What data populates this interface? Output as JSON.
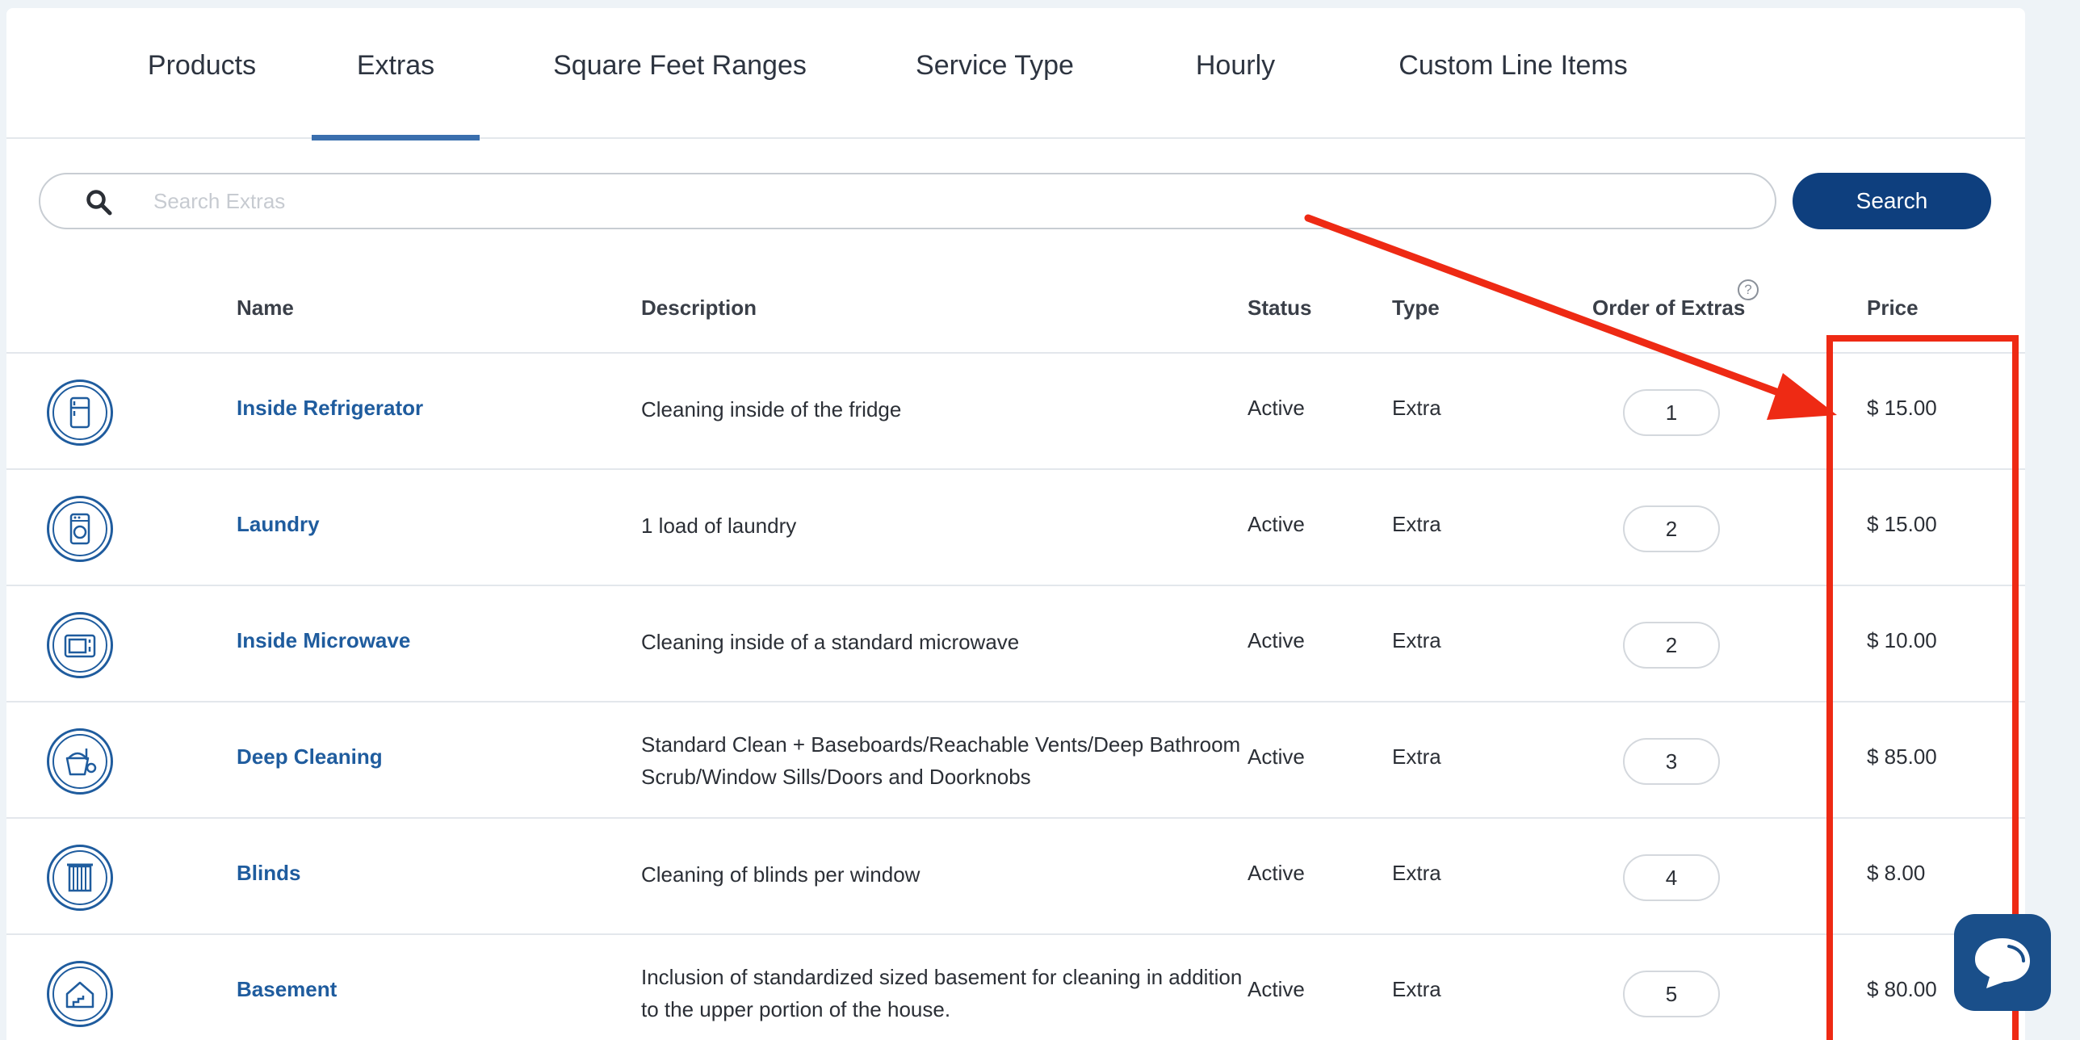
{
  "tabs": [
    {
      "label": "Products",
      "active": false
    },
    {
      "label": "Extras",
      "active": true
    },
    {
      "label": "Square Feet Ranges",
      "active": false
    },
    {
      "label": "Service Type",
      "active": false
    },
    {
      "label": "Hourly",
      "active": false
    },
    {
      "label": "Custom Line Items",
      "active": false
    }
  ],
  "search": {
    "placeholder": "Search Extras",
    "value": "",
    "button_label": "Search"
  },
  "table": {
    "columns": {
      "name": "Name",
      "description": "Description",
      "status": "Status",
      "type": "Type",
      "order": "Order of Extras",
      "price": "Price"
    },
    "help_icon_glyph": "?",
    "rows": [
      {
        "icon": "refrigerator-icon",
        "name": "Inside Refrigerator",
        "description": "Cleaning inside of the fridge",
        "status": "Active",
        "type": "Extra",
        "order": "1",
        "price": "$ 15.00"
      },
      {
        "icon": "washing-machine-icon",
        "name": "Laundry",
        "description": "1 load of laundry",
        "status": "Active",
        "type": "Extra",
        "order": "2",
        "price": "$ 15.00"
      },
      {
        "icon": "microwave-icon",
        "name": "Inside Microwave",
        "description": "Cleaning inside of a standard microwave",
        "status": "Active",
        "type": "Extra",
        "order": "2",
        "price": "$ 10.00"
      },
      {
        "icon": "cleaning-bucket-icon",
        "name": "Deep Cleaning",
        "description": "Standard Clean + Baseboards/Reachable Vents/Deep Bathroom Scrub/Window Sills/Doors and Doorknobs",
        "status": "Active",
        "type": "Extra",
        "order": "3",
        "price": "$ 85.00"
      },
      {
        "icon": "blinds-icon",
        "name": "Blinds",
        "description": "Cleaning of blinds per window",
        "status": "Active",
        "type": "Extra",
        "order": "4",
        "price": "$ 8.00"
      },
      {
        "icon": "basement-icon",
        "name": "Basement",
        "description": "Inclusion of standardized sized basement for cleaning in addition to the upper portion of the house.",
        "status": "Active",
        "type": "Extra",
        "order": "5",
        "price": "$ 80.00"
      }
    ]
  },
  "annotation": {
    "color": "#ee2a14"
  },
  "colors": {
    "accent": "#3a6fae",
    "button": "#0e3f7e",
    "link": "#1f5c9e",
    "chat": "#1a4f8a"
  },
  "chat_widget": {
    "icon": "chat-bubble-icon"
  }
}
